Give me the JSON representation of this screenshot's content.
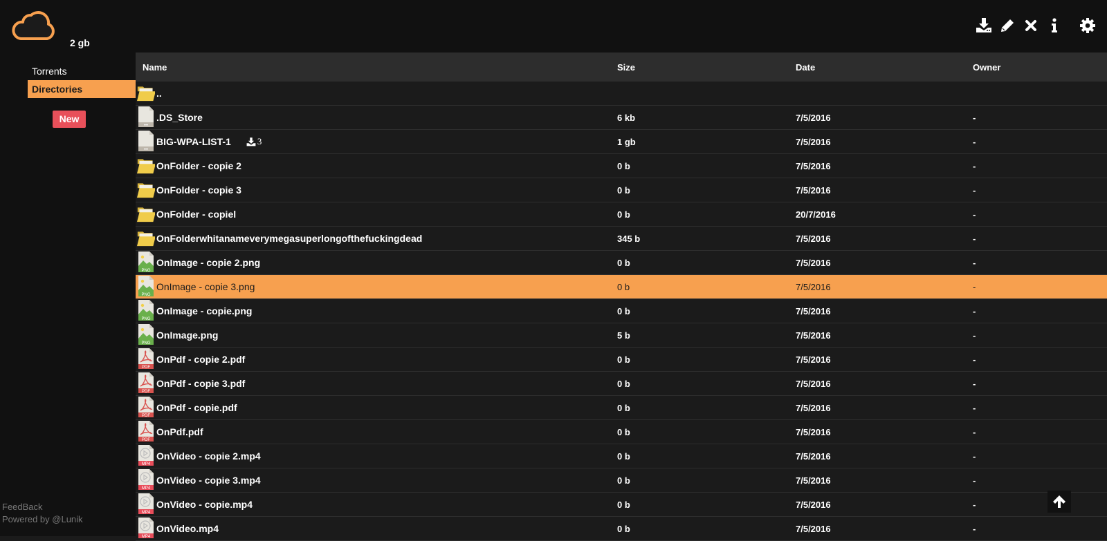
{
  "header": {
    "logo_icon": "cloud-icon",
    "space_used": "2 gb",
    "tools": [
      {
        "name": "download-icon",
        "label": "Download"
      },
      {
        "name": "pencil-icon",
        "label": "Rename"
      },
      {
        "name": "close-icon",
        "label": "Delete"
      },
      {
        "name": "info-icon",
        "label": "Info"
      },
      {
        "name": "gear-icon",
        "label": "Settings"
      }
    ]
  },
  "sidebar": {
    "items": [
      {
        "label": "Torrents",
        "active": false
      },
      {
        "label": "Directories",
        "active": true
      }
    ],
    "new_button": "New",
    "feedback": "FeedBack",
    "powered_by": "Powered by @Lunik"
  },
  "colors": {
    "accent": "#f7a04f",
    "new_button": "#e8505a",
    "folder": "#f0cc4a",
    "png": "#6ab04c",
    "pdf": "#d9534f",
    "mp4": "#e84d5a"
  },
  "table": {
    "columns": [
      "Name",
      "Size",
      "Date",
      "Owner"
    ],
    "rows": [
      {
        "type": "folder",
        "name": "..",
        "size": "",
        "date": "",
        "owner": ""
      },
      {
        "type": "file",
        "name": ".DS_Store",
        "size": "6 kb",
        "date": "7/5/2016",
        "owner": "-"
      },
      {
        "type": "file",
        "name": "BIG-WPA-LIST-1",
        "size": "1 gb",
        "date": "7/5/2016",
        "owner": "-",
        "downloads": "3"
      },
      {
        "type": "folder",
        "name": "OnFolder - copie 2",
        "size": "0 b",
        "date": "7/5/2016",
        "owner": "-"
      },
      {
        "type": "folder",
        "name": "OnFolder - copie 3",
        "size": "0 b",
        "date": "7/5/2016",
        "owner": "-"
      },
      {
        "type": "folder",
        "name": "OnFolder - copiel",
        "size": "0 b",
        "date": "20/7/2016",
        "owner": "-"
      },
      {
        "type": "folder",
        "name": "OnFolderwhitanameverymegasuperlongofthefuckingdead",
        "size": "345 b",
        "date": "7/5/2016",
        "owner": "-"
      },
      {
        "type": "png",
        "name": "OnImage - copie 2.png",
        "size": "0 b",
        "date": "7/5/2016",
        "owner": "-"
      },
      {
        "type": "png",
        "name": "OnImage - copie 3.png",
        "size": "0 b",
        "date": "7/5/2016",
        "owner": "-",
        "selected": true
      },
      {
        "type": "png",
        "name": "OnImage - copie.png",
        "size": "0 b",
        "date": "7/5/2016",
        "owner": "-"
      },
      {
        "type": "png",
        "name": "OnImage.png",
        "size": "5 b",
        "date": "7/5/2016",
        "owner": "-"
      },
      {
        "type": "pdf",
        "name": "OnPdf - copie 2.pdf",
        "size": "0 b",
        "date": "7/5/2016",
        "owner": "-"
      },
      {
        "type": "pdf",
        "name": "OnPdf - copie 3.pdf",
        "size": "0 b",
        "date": "7/5/2016",
        "owner": "-"
      },
      {
        "type": "pdf",
        "name": "OnPdf - copie.pdf",
        "size": "0 b",
        "date": "7/5/2016",
        "owner": "-"
      },
      {
        "type": "pdf",
        "name": "OnPdf.pdf",
        "size": "0 b",
        "date": "7/5/2016",
        "owner": "-"
      },
      {
        "type": "mp4",
        "name": "OnVideo - copie 2.mp4",
        "size": "0 b",
        "date": "7/5/2016",
        "owner": "-"
      },
      {
        "type": "mp4",
        "name": "OnVideo - copie 3.mp4",
        "size": "0 b",
        "date": "7/5/2016",
        "owner": "-"
      },
      {
        "type": "mp4",
        "name": "OnVideo - copie.mp4",
        "size": "0 b",
        "date": "7/5/2016",
        "owner": "-"
      },
      {
        "type": "mp4",
        "name": "OnVideo.mp4",
        "size": "0 b",
        "date": "7/5/2016",
        "owner": "-"
      }
    ]
  },
  "scroll_top_icon": "arrow-up-icon"
}
